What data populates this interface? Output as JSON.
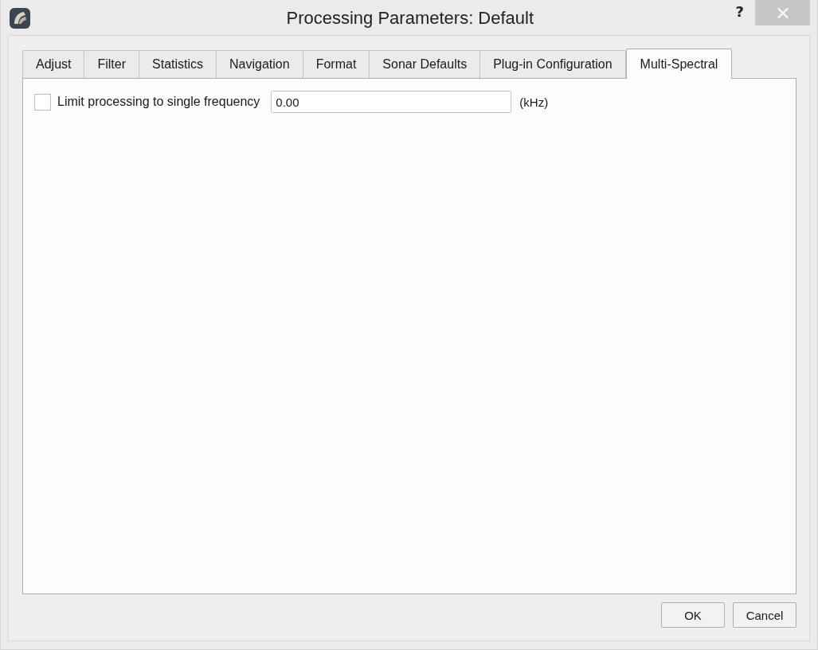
{
  "window": {
    "title": "Processing Parameters: Default",
    "help": "?"
  },
  "tabs": [
    {
      "label": "Adjust",
      "selected": false
    },
    {
      "label": "Filter",
      "selected": false
    },
    {
      "label": "Statistics",
      "selected": false
    },
    {
      "label": "Navigation",
      "selected": false
    },
    {
      "label": "Format",
      "selected": false
    },
    {
      "label": "Sonar Defaults",
      "selected": false
    },
    {
      "label": "Plug-in Configuration",
      "selected": false
    },
    {
      "label": "Multi-Spectral",
      "selected": true
    }
  ],
  "panel": {
    "checkbox": {
      "label": "Limit processing to single frequency",
      "checked": false
    },
    "frequency_field": {
      "value": "0.00",
      "unit": "(kHz)"
    }
  },
  "buttons": [
    {
      "label": "OK"
    },
    {
      "label": "Cancel"
    }
  ]
}
